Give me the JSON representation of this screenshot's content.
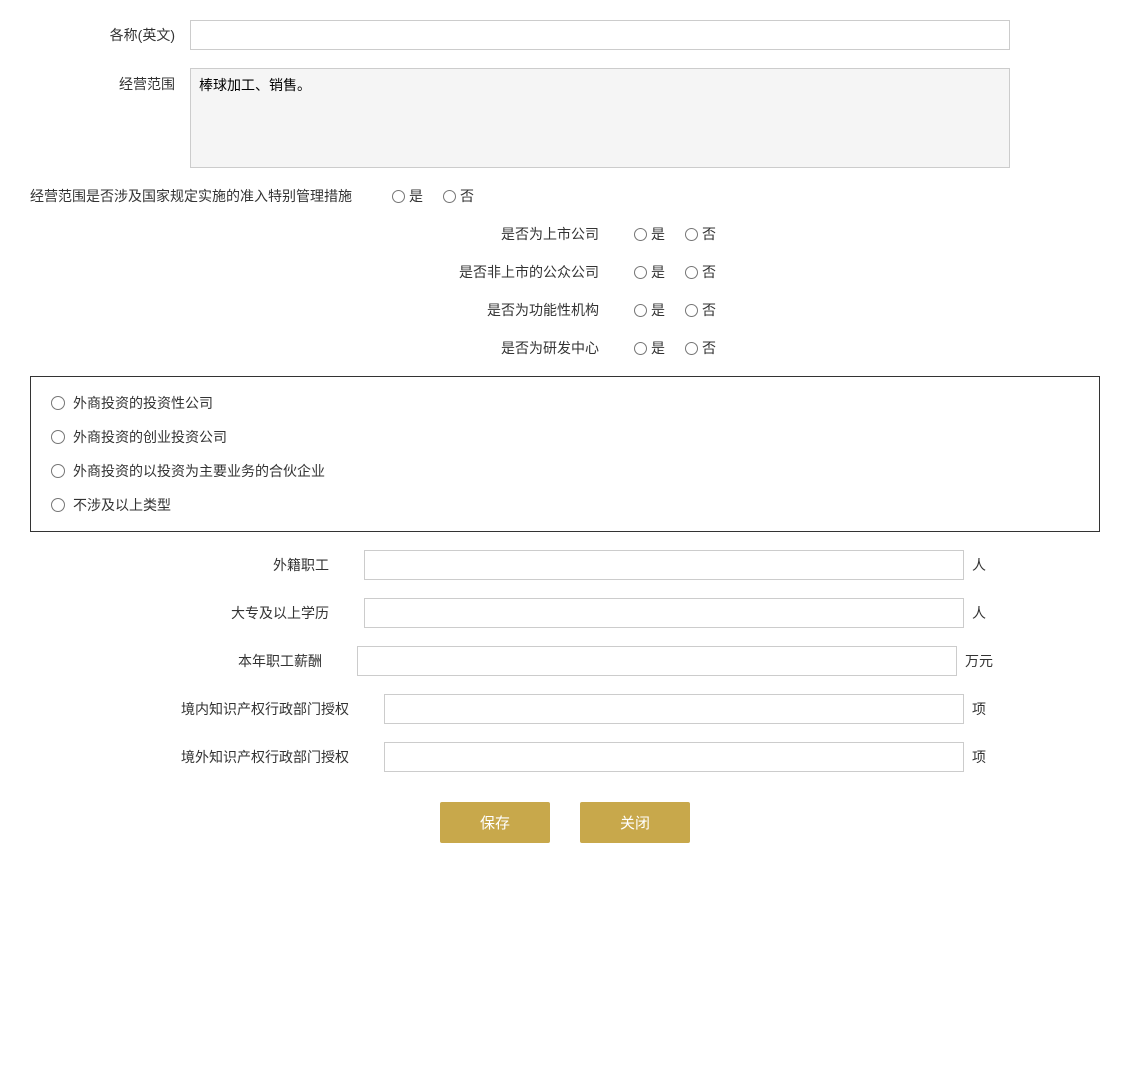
{
  "form": {
    "name_en_label": "各称(英文)",
    "business_scope_label": "经营范围",
    "business_scope_value": "棒球加工、销售。",
    "special_management_label": "经营范围是否涉及国家规定实施的准入特别管理措施",
    "yes_label": "是",
    "no_label": "否",
    "listed_company_label": "是否为上市公司",
    "non_listed_public_label": "是否非上市的公众公司",
    "functional_org_label": "是否为功能性机构",
    "rd_center_label": "是否为研发中心",
    "investment_company_label": "外商投资的投资性公司",
    "venture_investment_label": "外商投资的创业投资公司",
    "partnership_investment_label": "外商投资的以投资为主要业务的合伙企业",
    "not_applicable_label": "不涉及以上类型",
    "foreign_employees_label": "外籍职工",
    "foreign_employees_unit": "人",
    "college_education_label": "大专及以上学历",
    "college_education_unit": "人",
    "annual_salary_label": "本年职工薪酬",
    "annual_salary_unit": "万元",
    "domestic_ip_label": "境内知识产权行政部门授权",
    "domestic_ip_unit": "项",
    "overseas_ip_label": "境外知识产权行政部门授权",
    "overseas_ip_unit": "项",
    "save_button": "保存",
    "close_button": "关闭"
  }
}
